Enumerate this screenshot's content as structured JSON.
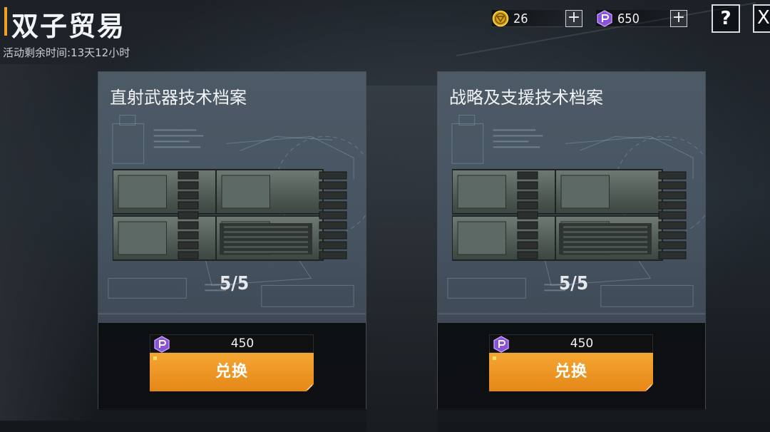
{
  "header": {
    "title": "双子贸易",
    "event_time": "活动剩余时间:13天12小时"
  },
  "currencies": [
    {
      "icon": "gold-coin-icon",
      "value": "26",
      "color": "#f0c020"
    },
    {
      "icon": "purple-token-icon",
      "value": "650",
      "color": "#a070e0"
    }
  ],
  "buttons": {
    "plus": "+",
    "help": "?",
    "close": "X"
  },
  "cards": [
    {
      "name": "直射武器技术档案",
      "stock": "5/5",
      "price": "450",
      "exchange_label": "兑换"
    },
    {
      "name": "战略及支援技术档案",
      "stock": "5/5",
      "price": "450",
      "exchange_label": "兑换"
    }
  ],
  "colors": {
    "accent": "#f0a020",
    "exchange_button": "#ee961f",
    "card_bg": "#4a5763"
  }
}
